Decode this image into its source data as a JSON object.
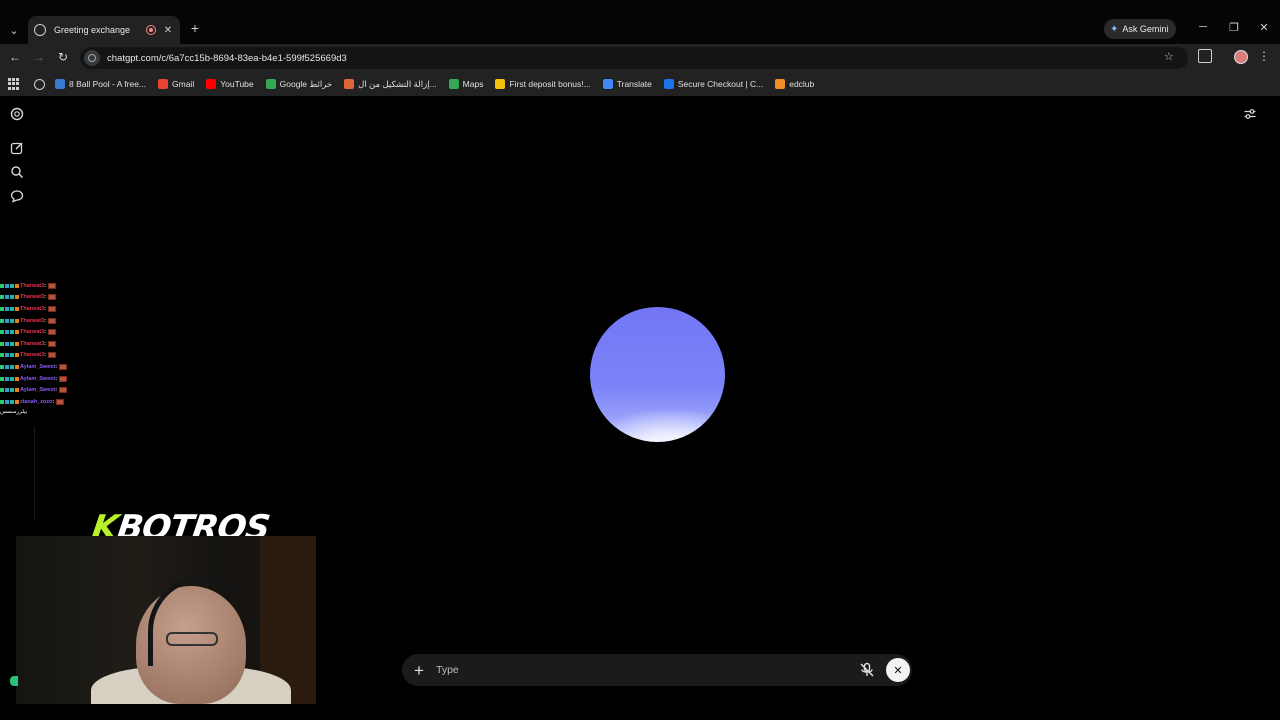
{
  "browser": {
    "tab": {
      "title": "Greeting exchange"
    },
    "new_tab_glyph": "+",
    "gemini_label": "Ask Gemini",
    "url": "chatgpt.com/c/6a7cc15b-8694-83ea-b4e1-599f525669d3",
    "bookmarks": [
      {
        "label": "8 Ball Pool - A free...",
        "icon": "8-ball-pool-icon",
        "color": "#3a7bd5"
      },
      {
        "label": "Gmail",
        "icon": "gmail-icon",
        "color": "#ea4335"
      },
      {
        "label": "YouTube",
        "icon": "youtube-icon",
        "color": "#ff0000"
      },
      {
        "label": "Google خرائط",
        "icon": "google-maps-icon",
        "color": "#34a853"
      },
      {
        "label": "إزالة التشكيل من ال...",
        "icon": "bookmark-favicon-icon",
        "color": "#e0663a"
      },
      {
        "label": "Maps",
        "icon": "maps-pin-icon",
        "color": "#34a853"
      },
      {
        "label": "First deposit bonus!...",
        "icon": "coin-icon",
        "color": "#f4c20d"
      },
      {
        "label": "Translate",
        "icon": "translate-icon",
        "color": "#4285f4"
      },
      {
        "label": "Secure Checkout | C...",
        "icon": "checkout-icon",
        "color": "#1a73e8"
      },
      {
        "label": "edclub",
        "icon": "edclub-icon",
        "color": "#f28c28"
      }
    ]
  },
  "stream_overlay": {
    "chat_lines": [
      {
        "user": "Tharwat3",
        "color": "#e5334b"
      },
      {
        "user": "Tharwat3",
        "color": "#e5334b"
      },
      {
        "user": "Tharwat3",
        "color": "#e5334b"
      },
      {
        "user": "Tharwat3",
        "color": "#e5334b"
      },
      {
        "user": "Tharwat3",
        "color": "#e5334b"
      },
      {
        "user": "Tharwat3",
        "color": "#e5334b"
      },
      {
        "user": "Tharwat3",
        "color": "#e5334b"
      },
      {
        "user": "Aylam_Sweet",
        "color": "#8a5cf5"
      },
      {
        "user": "Aylam_Sweet",
        "color": "#8a5cf5"
      },
      {
        "user": "Aylam_Sweet",
        "color": "#8a5cf5"
      },
      {
        "user": "zianah_zozo",
        "color": "#8a5cf5"
      }
    ],
    "last_line": "بيلررسسس",
    "logo_k": "K",
    "logo_rest": "BOTROS"
  },
  "composer": {
    "plus_glyph": "+",
    "placeholder": "Type",
    "close_glyph": "✕"
  },
  "colors": {
    "orb_top": "#7276f4",
    "orb_highlight": "#ffffff",
    "logo_accent": "#b8f02a"
  }
}
